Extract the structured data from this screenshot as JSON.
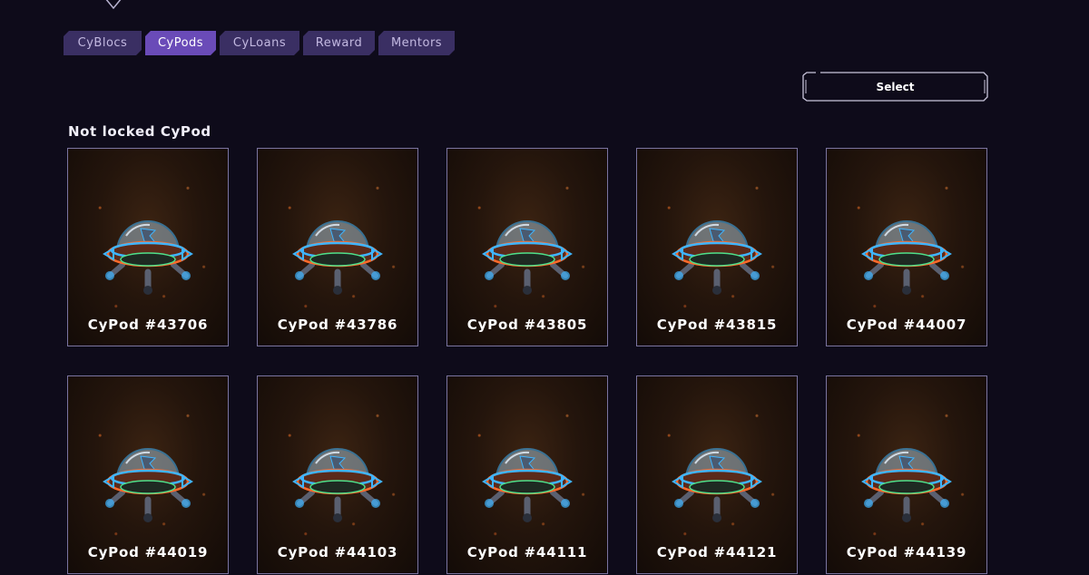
{
  "tabs": [
    {
      "label": "CyBlocs",
      "active": false
    },
    {
      "label": "CyPods",
      "active": true
    },
    {
      "label": "CyLoans",
      "active": false
    },
    {
      "label": "Reward",
      "active": false
    },
    {
      "label": "Mentors",
      "active": false
    }
  ],
  "select_button": {
    "label": "Select"
  },
  "section": {
    "title": "Not locked CyPod"
  },
  "cards": [
    {
      "name": "CyPod #43706"
    },
    {
      "name": "CyPod #43786"
    },
    {
      "name": "CyPod #43805"
    },
    {
      "name": "CyPod #43815"
    },
    {
      "name": "CyPod #44007"
    },
    {
      "name": "CyPod #44019"
    },
    {
      "name": "CyPod #44103"
    },
    {
      "name": "CyPod #44111"
    },
    {
      "name": "CyPod #44121"
    },
    {
      "name": "CyPod #44139"
    }
  ],
  "colors": {
    "background": "#0e0b1a",
    "tab": "#3a2f63",
    "tab_active": "#6a4bb8",
    "card_border": "#7a74a0",
    "neon": "#3fb5ff"
  },
  "icons": {
    "top": "chevron-down-icon",
    "card_image": "cypod-image"
  }
}
